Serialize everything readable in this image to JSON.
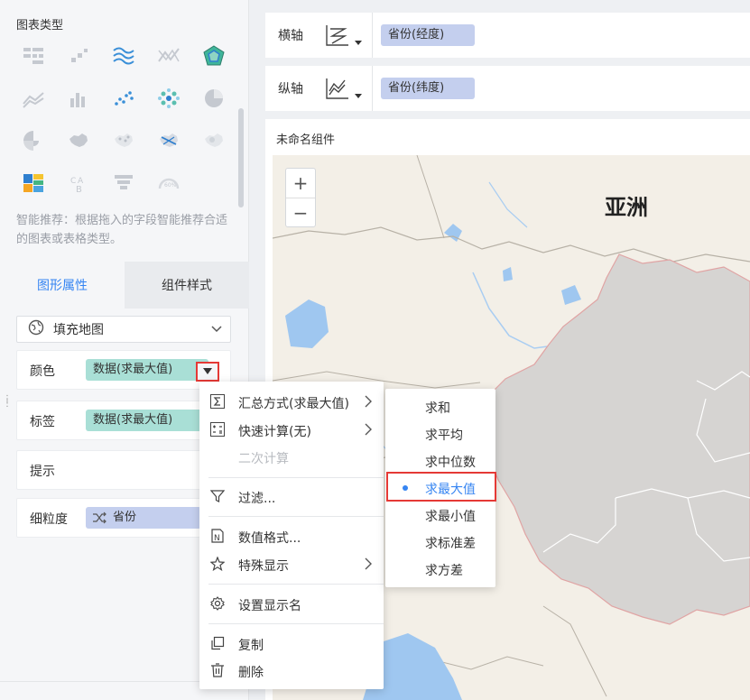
{
  "left_panel": {
    "section_title": "图表类型",
    "hint": "智能推荐：根据拖入的字段智能推荐合适的图表或表格类型。",
    "tabs": [
      {
        "label": "图形属性",
        "active": true
      },
      {
        "label": "组件样式",
        "active": false
      }
    ],
    "chart_select": "填充地图",
    "properties": [
      {
        "label": "颜色",
        "pill": "数据(求最大值)",
        "pill_color": "#a9dfd6"
      },
      {
        "label": "标签",
        "pill": "数据(求最大值)",
        "pill_color": "#a9dfd6"
      },
      {
        "label": "提示",
        "pill": ""
      },
      {
        "label": "细粒度",
        "pill": "省份",
        "pill_color": "#c4cfee"
      }
    ]
  },
  "axes": {
    "x_label": "横轴",
    "x_field": "省份(经度)",
    "y_label": "纵轴",
    "y_field": "省份(纬度)"
  },
  "component": {
    "title": "未命名组件",
    "map_label": "亚洲",
    "zoom_in": "+",
    "zoom_out": "−"
  },
  "context_menu": {
    "items": [
      {
        "icon": "sigma-icon",
        "label": "汇总方式(求最大值)",
        "submenu": true
      },
      {
        "icon": "quick-calc-icon",
        "label": "快速计算(无)",
        "submenu": true
      },
      {
        "icon": "",
        "label": "二次计算",
        "disabled": true
      },
      {
        "icon": "filter-icon",
        "label": "过滤..."
      },
      {
        "icon": "number-format-icon",
        "label": "数值格式..."
      },
      {
        "icon": "star-icon",
        "label": "特殊显示",
        "submenu": true
      },
      {
        "icon": "gear-icon",
        "label": "设置显示名"
      },
      {
        "icon": "copy-icon",
        "label": "复制"
      },
      {
        "icon": "trash-icon",
        "label": "删除"
      }
    ]
  },
  "aggregation_submenu": {
    "options": [
      "求和",
      "求平均",
      "求中位数",
      "求最大值",
      "求最小值",
      "求标准差",
      "求方差"
    ],
    "selected": "求最大值"
  },
  "colors": {
    "accent": "#3685f2",
    "highlight_border": "#e53935"
  }
}
